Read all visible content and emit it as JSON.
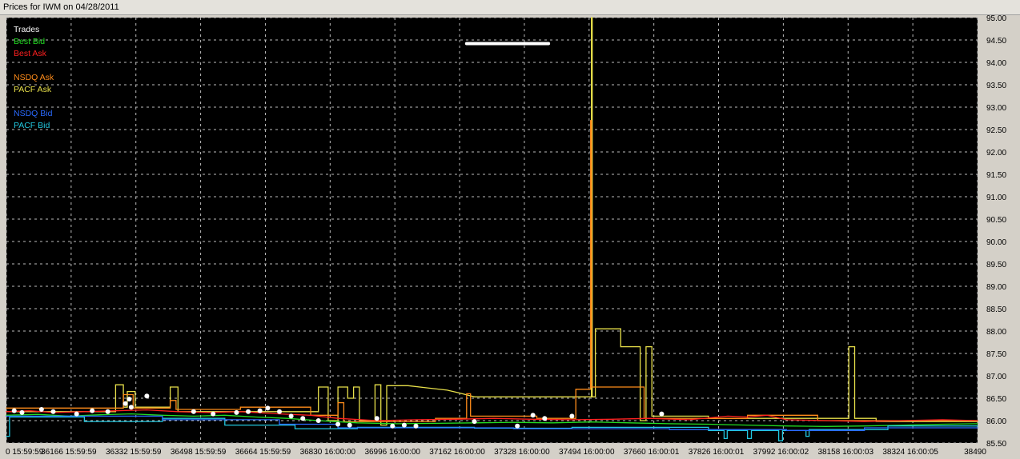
{
  "window": {
    "title": "Prices for IWM on 04/28/2011"
  },
  "colors": {
    "background": "#000000",
    "grid": "#bdbdbd",
    "trades": "#ffffff",
    "best_bid": "#22dd22",
    "best_ask": "#ff2020",
    "nsdq_ask": "#ff8c1a",
    "pacf_ask": "#e8e04a",
    "nsdq_bid": "#2a6aff",
    "pacf_bid": "#22c8e0"
  },
  "chart_data": {
    "type": "line",
    "title": "Prices for IWM on 04/28/2011",
    "xlabel": "",
    "ylabel": "",
    "ylim": [
      85.5,
      95.0
    ],
    "xlim": [
      36000,
      38490
    ],
    "grid": true,
    "legend_position": "top-left",
    "y_ticks": [
      "85.50",
      "86.00",
      "86.50",
      "87.00",
      "87.50",
      "88.00",
      "88.50",
      "89.00",
      "89.50",
      "90.00",
      "90.50",
      "91.00",
      "91.50",
      "92.00",
      "92.50",
      "93.00",
      "93.50",
      "94.00",
      "94.50",
      "95.00"
    ],
    "x_ticks": [
      {
        "value": 36000,
        "label": "0 15:59:59"
      },
      {
        "value": 36166,
        "label": "36166 15:59:59"
      },
      {
        "value": 36332,
        "label": "36332 15:59:59"
      },
      {
        "value": 36498,
        "label": "36498 15:59:59"
      },
      {
        "value": 36664,
        "label": "36664 15:59:59"
      },
      {
        "value": 36830,
        "label": "36830 16:00:00"
      },
      {
        "value": 36996,
        "label": "36996 16:00:00"
      },
      {
        "value": 37162,
        "label": "37162 16:00:00"
      },
      {
        "value": 37328,
        "label": "37328 16:00:00"
      },
      {
        "value": 37494,
        "label": "37494 16:00:00"
      },
      {
        "value": 37660,
        "label": "37660 16:00:01"
      },
      {
        "value": 37826,
        "label": "37826 16:00:01"
      },
      {
        "value": 37992,
        "label": "37992 16:00:02"
      },
      {
        "value": 38158,
        "label": "38158 16:00:03"
      },
      {
        "value": 38324,
        "label": "38324 16:00:05"
      },
      {
        "value": 38490,
        "label": "38490"
      }
    ],
    "legend": [
      {
        "name": "Trades",
        "color": "#ffffff"
      },
      {
        "name": "Best Bid",
        "color": "#22dd22"
      },
      {
        "name": "Best Ask",
        "color": "#ff2020"
      },
      {
        "name": "NSDQ Ask",
        "color": "#ff8c1a"
      },
      {
        "name": "PACF Ask",
        "color": "#e8e04a"
      },
      {
        "name": "NSDQ Bid",
        "color": "#2a6aff"
      },
      {
        "name": "PACF Bid",
        "color": "#22c8e0"
      }
    ],
    "series": [
      {
        "name": "PACF Ask",
        "color": "#e8e04a",
        "style": "step",
        "points": [
          [
            36000,
            86.2
          ],
          [
            36280,
            86.2
          ],
          [
            36280,
            86.8
          ],
          [
            36300,
            86.8
          ],
          [
            36300,
            86.3
          ],
          [
            36310,
            86.3
          ],
          [
            36310,
            86.65
          ],
          [
            36330,
            86.65
          ],
          [
            36330,
            86.3
          ],
          [
            36420,
            86.3
          ],
          [
            36420,
            86.75
          ],
          [
            36440,
            86.75
          ],
          [
            36440,
            86.2
          ],
          [
            36800,
            86.2
          ],
          [
            36800,
            86.75
          ],
          [
            36825,
            86.75
          ],
          [
            36825,
            86.0
          ],
          [
            36850,
            86.0
          ],
          [
            36850,
            86.75
          ],
          [
            36875,
            86.75
          ],
          [
            36875,
            86.5
          ],
          [
            36890,
            86.5
          ],
          [
            36890,
            86.75
          ],
          [
            36905,
            86.75
          ],
          [
            36905,
            86.0
          ],
          [
            36945,
            86.0
          ],
          [
            36945,
            86.8
          ],
          [
            36960,
            86.8
          ],
          [
            36960,
            85.9
          ],
          [
            36975,
            85.9
          ],
          [
            36975,
            86.78
          ],
          [
            37030,
            86.78
          ],
          [
            37080,
            86.73
          ],
          [
            37130,
            86.68
          ],
          [
            37160,
            86.62
          ],
          [
            37200,
            86.53
          ],
          [
            37500,
            86.53
          ],
          [
            37500,
            95.0
          ],
          [
            37502,
            95.0
          ],
          [
            37502,
            86.53
          ],
          [
            37510,
            86.53
          ],
          [
            37510,
            88.05
          ],
          [
            37575,
            88.05
          ],
          [
            37575,
            87.65
          ],
          [
            37625,
            87.65
          ],
          [
            37625,
            86.0
          ],
          [
            37640,
            86.0
          ],
          [
            37640,
            87.65
          ],
          [
            37655,
            87.65
          ],
          [
            37655,
            86.1
          ],
          [
            37800,
            86.1
          ],
          [
            37800,
            86.05
          ],
          [
            38160,
            86.05
          ],
          [
            38160,
            87.65
          ],
          [
            38175,
            87.65
          ],
          [
            38175,
            86.05
          ],
          [
            38230,
            86.05
          ],
          [
            38230,
            85.98
          ],
          [
            38490,
            85.98
          ]
        ]
      },
      {
        "name": "NSDQ Ask",
        "color": "#ff8c1a",
        "style": "step",
        "points": [
          [
            36000,
            86.28
          ],
          [
            36300,
            86.28
          ],
          [
            36300,
            86.58
          ],
          [
            36325,
            86.58
          ],
          [
            36325,
            86.28
          ],
          [
            36420,
            86.28
          ],
          [
            36420,
            86.45
          ],
          [
            36435,
            86.45
          ],
          [
            36435,
            86.25
          ],
          [
            36600,
            86.25
          ],
          [
            36600,
            86.3
          ],
          [
            36780,
            86.3
          ],
          [
            36780,
            86.12
          ],
          [
            36850,
            86.12
          ],
          [
            36850,
            86.4
          ],
          [
            36865,
            86.4
          ],
          [
            36865,
            85.98
          ],
          [
            37100,
            85.98
          ],
          [
            37100,
            86.05
          ],
          [
            37180,
            86.05
          ],
          [
            37180,
            86.6
          ],
          [
            37190,
            86.6
          ],
          [
            37190,
            86.1
          ],
          [
            37360,
            86.1
          ],
          [
            37360,
            86.05
          ],
          [
            37460,
            86.05
          ],
          [
            37460,
            86.7
          ],
          [
            37498,
            86.7
          ],
          [
            37498,
            92.7
          ],
          [
            37500,
            92.7
          ],
          [
            37500,
            86.75
          ],
          [
            37635,
            86.75
          ],
          [
            37635,
            86.05
          ],
          [
            37900,
            86.05
          ],
          [
            37900,
            86.12
          ],
          [
            38080,
            86.12
          ],
          [
            38080,
            86.0
          ],
          [
            38490,
            86.0
          ]
        ]
      },
      {
        "name": "Best Ask",
        "color": "#ff2020",
        "style": "line",
        "points": [
          [
            36000,
            86.2
          ],
          [
            36060,
            86.22
          ],
          [
            36120,
            86.18
          ],
          [
            36200,
            86.2
          ],
          [
            36280,
            86.22
          ],
          [
            36360,
            86.24
          ],
          [
            36440,
            86.2
          ],
          [
            36520,
            86.18
          ],
          [
            36600,
            86.2
          ],
          [
            36700,
            86.15
          ],
          [
            36780,
            86.12
          ],
          [
            36850,
            86.05
          ],
          [
            36950,
            86.0
          ],
          [
            37050,
            86.02
          ],
          [
            37150,
            86.03
          ],
          [
            37250,
            86.05
          ],
          [
            37350,
            86.03
          ],
          [
            37450,
            86.02
          ],
          [
            37550,
            86.03
          ],
          [
            37650,
            86.05
          ],
          [
            37750,
            86.02
          ],
          [
            37800,
            86.06
          ],
          [
            37850,
            86.1
          ],
          [
            37900,
            86.08
          ],
          [
            37950,
            86.12
          ],
          [
            38000,
            86.02
          ],
          [
            38100,
            86.0
          ],
          [
            38200,
            85.98
          ],
          [
            38300,
            86.0
          ],
          [
            38400,
            86.02
          ],
          [
            38490,
            86.0
          ]
        ]
      },
      {
        "name": "Best Bid",
        "color": "#22dd22",
        "style": "line",
        "points": [
          [
            36000,
            86.12
          ],
          [
            36080,
            86.14
          ],
          [
            36160,
            86.1
          ],
          [
            36240,
            86.13
          ],
          [
            36320,
            86.15
          ],
          [
            36400,
            86.12
          ],
          [
            36480,
            86.1
          ],
          [
            36560,
            86.12
          ],
          [
            36640,
            86.08
          ],
          [
            36720,
            86.05
          ],
          [
            36800,
            86.0
          ],
          [
            36900,
            85.95
          ],
          [
            37000,
            85.93
          ],
          [
            37100,
            85.94
          ],
          [
            37200,
            85.95
          ],
          [
            37300,
            85.96
          ],
          [
            37400,
            85.95
          ],
          [
            37500,
            85.97
          ],
          [
            37600,
            85.95
          ],
          [
            37700,
            85.93
          ],
          [
            37800,
            85.92
          ],
          [
            37900,
            85.9
          ],
          [
            38000,
            85.88
          ],
          [
            38100,
            85.87
          ],
          [
            38200,
            85.88
          ],
          [
            38300,
            85.9
          ],
          [
            38400,
            85.92
          ],
          [
            38490,
            85.93
          ]
        ]
      },
      {
        "name": "PACF Bid",
        "color": "#22c8e0",
        "style": "step",
        "points": [
          [
            36000,
            85.65
          ],
          [
            36008,
            85.65
          ],
          [
            36008,
            86.08
          ],
          [
            36200,
            86.08
          ],
          [
            36200,
            85.98
          ],
          [
            36400,
            85.98
          ],
          [
            36400,
            86.05
          ],
          [
            36560,
            86.05
          ],
          [
            36560,
            85.9
          ],
          [
            36740,
            85.9
          ],
          [
            36740,
            85.82
          ],
          [
            36900,
            85.82
          ],
          [
            36900,
            85.85
          ],
          [
            37200,
            85.85
          ],
          [
            37200,
            85.83
          ],
          [
            37450,
            85.83
          ],
          [
            37450,
            85.85
          ],
          [
            37800,
            85.85
          ],
          [
            37800,
            85.78
          ],
          [
            37840,
            85.78
          ],
          [
            37840,
            85.6
          ],
          [
            37848,
            85.6
          ],
          [
            37848,
            85.78
          ],
          [
            37900,
            85.78
          ],
          [
            37900,
            85.6
          ],
          [
            37910,
            85.6
          ],
          [
            37910,
            85.78
          ],
          [
            37980,
            85.78
          ],
          [
            37980,
            85.55
          ],
          [
            37990,
            85.55
          ],
          [
            37990,
            85.78
          ],
          [
            38050,
            85.78
          ],
          [
            38050,
            85.65
          ],
          [
            38058,
            85.65
          ],
          [
            38058,
            85.8
          ],
          [
            38260,
            85.8
          ],
          [
            38260,
            85.88
          ],
          [
            38490,
            85.88
          ]
        ]
      },
      {
        "name": "NSDQ Bid",
        "color": "#2a6aff",
        "style": "step",
        "points": [
          [
            36000,
            86.1
          ],
          [
            36400,
            86.1
          ],
          [
            36400,
            86.02
          ],
          [
            36700,
            86.02
          ],
          [
            36700,
            85.92
          ],
          [
            36850,
            85.92
          ],
          [
            36850,
            85.84
          ],
          [
            37300,
            85.84
          ],
          [
            37300,
            85.82
          ],
          [
            37700,
            85.82
          ],
          [
            37700,
            85.8
          ],
          [
            38000,
            85.8
          ],
          [
            38000,
            85.78
          ],
          [
            38200,
            85.78
          ],
          [
            38200,
            85.84
          ],
          [
            38490,
            85.84
          ]
        ]
      },
      {
        "name": "Trades",
        "color": "#ffffff",
        "style": "points",
        "points": [
          [
            36020,
            86.22
          ],
          [
            36040,
            86.18
          ],
          [
            36090,
            86.25
          ],
          [
            36120,
            86.2
          ],
          [
            36180,
            86.15
          ],
          [
            36220,
            86.22
          ],
          [
            36260,
            86.2
          ],
          [
            36305,
            86.38
          ],
          [
            36315,
            86.48
          ],
          [
            36320,
            86.3
          ],
          [
            36360,
            86.55
          ],
          [
            36480,
            86.2
          ],
          [
            36530,
            86.15
          ],
          [
            36590,
            86.18
          ],
          [
            36620,
            86.2
          ],
          [
            36650,
            86.22
          ],
          [
            36670,
            86.28
          ],
          [
            36700,
            86.2
          ],
          [
            36730,
            86.1
          ],
          [
            36760,
            86.05
          ],
          [
            36800,
            86.0
          ],
          [
            36850,
            85.92
          ],
          [
            36880,
            85.9
          ],
          [
            36950,
            86.05
          ],
          [
            36990,
            85.88
          ],
          [
            37020,
            85.9
          ],
          [
            37050,
            85.88
          ],
          [
            37200,
            85.98
          ],
          [
            37310,
            85.88
          ],
          [
            37350,
            86.12
          ],
          [
            37380,
            86.05
          ],
          [
            37450,
            86.1
          ],
          [
            37680,
            86.15
          ]
        ]
      },
      {
        "name": "Trades",
        "color": "#ffffff",
        "style": "line",
        "points": [
          [
            37180,
            94.42
          ],
          [
            37390,
            94.42
          ]
        ]
      }
    ]
  }
}
